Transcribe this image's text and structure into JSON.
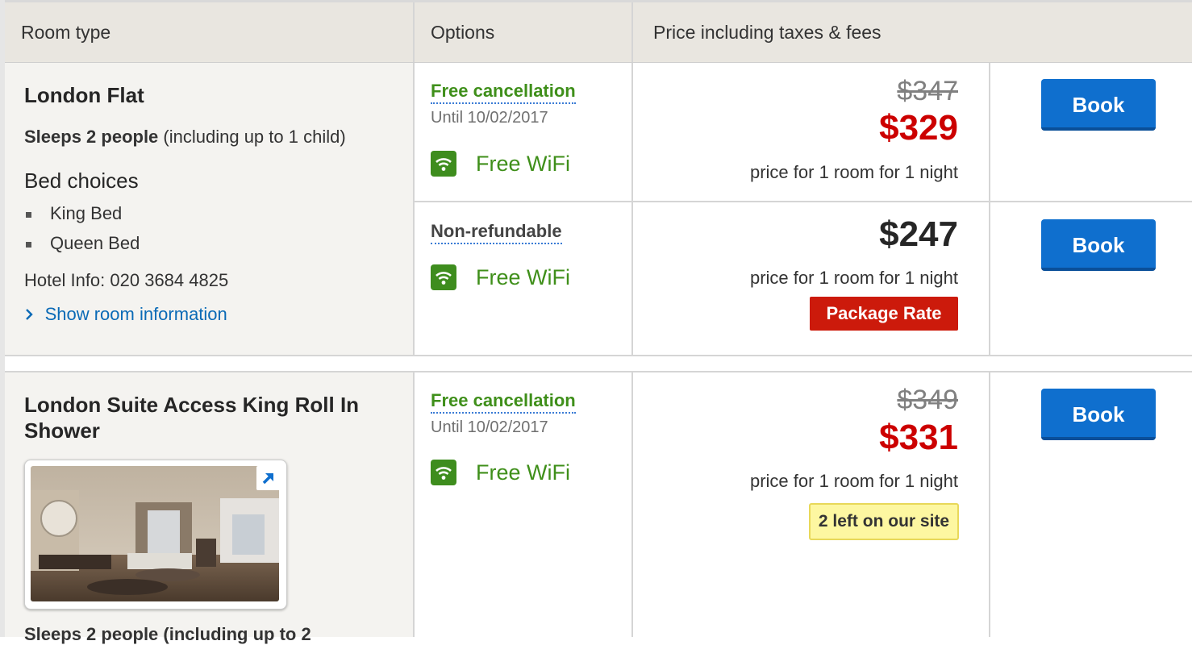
{
  "header": {
    "room_type": "Room type",
    "options": "Options",
    "price": "Price including taxes & fees"
  },
  "rooms": [
    {
      "title": "London Flat",
      "sleeps_bold": "Sleeps 2 people",
      "sleeps_rest": " (including up to 1 child)",
      "bed_title": "Bed choices",
      "beds": [
        "King Bed",
        "Queen Bed"
      ],
      "hotel_info": "Hotel Info: 020 3684 4825",
      "show_link": "Show room information",
      "options": [
        {
          "policy": "Free cancellation",
          "until": "Until 10/02/2017",
          "amenity": "Free WiFi",
          "old_price": "$347",
          "price": "$329",
          "per_night": "price for 1 room for 1 night",
          "book": "Book"
        },
        {
          "policy": "Non-refundable",
          "amenity": "Free WiFi",
          "price": "$247",
          "per_night": "price for 1 room for 1 night",
          "badge": "Package Rate",
          "book": "Book"
        }
      ]
    },
    {
      "title": "London Suite Access King Roll In Shower",
      "sleeps_partial": "Sleeps 2 people (including up to 2",
      "options": [
        {
          "policy": "Free cancellation",
          "until": "Until 10/02/2017",
          "amenity": "Free WiFi",
          "old_price": "$349",
          "price": "$331",
          "per_night": "price for 1 room for 1 night",
          "badge": "2 left on our site",
          "book": "Book"
        }
      ]
    }
  ],
  "icons": {
    "wifi": "wifi-icon",
    "chevron": "chevron-right-icon",
    "expand": "expand-arrow-icon"
  },
  "colors": {
    "book_button": "#0f6fce",
    "sale_price": "#cc0000",
    "amenity_green": "#3f8f1a",
    "package_badge": "#cc1a0b",
    "availability_badge": "#fdf7a1"
  }
}
